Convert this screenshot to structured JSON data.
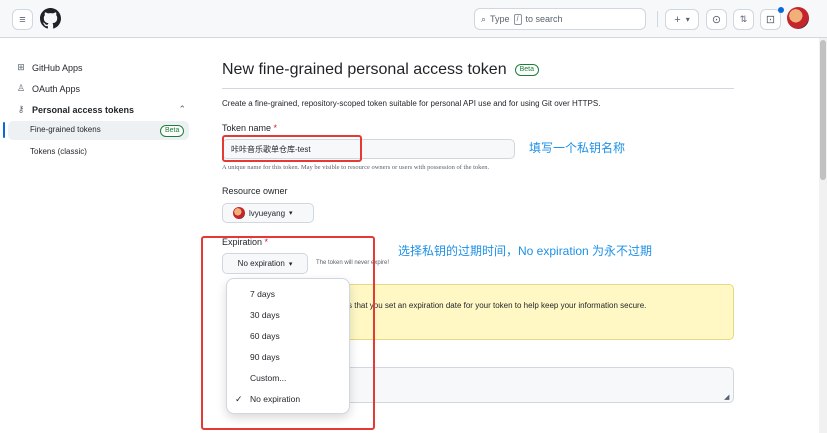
{
  "header": {
    "menu_icon": "hamburger-icon",
    "logo_icon": "github-logo-icon",
    "search_placeholder_pre": "Type",
    "search_key": "/",
    "search_placeholder_post": "to search",
    "plus_label": "+",
    "plus_caret": "▾",
    "issues_icon": "issue-circle-icon",
    "pr_icon": "pull-request-icon",
    "inbox_icon": "inbox-icon",
    "notification_color": "#0969da"
  },
  "sidebar": {
    "items": [
      {
        "icon": "apps-grid-icon",
        "glyph": "⊞",
        "label": "GitHub Apps"
      },
      {
        "icon": "person-icon",
        "glyph": "♙",
        "label": "OAuth Apps"
      },
      {
        "icon": "key-icon",
        "glyph": "⚷",
        "label": "Personal access tokens",
        "chevron": "⌃"
      }
    ],
    "sub_items": [
      {
        "label": "Fine-grained tokens",
        "badge": "Beta",
        "active": true
      },
      {
        "label": "Tokens (classic)"
      }
    ]
  },
  "main": {
    "title": "New fine-grained personal access token",
    "title_badge": "Beta",
    "description": "Create a fine-grained, repository-scoped token suitable for personal API use and for using Git over HTTPS.",
    "token_name_label": "Token name",
    "required_mark": "*",
    "token_name_value": "咔咔音乐歌单仓库-test",
    "token_name_hint": "A unique name for this token. May be visible to resource owners or users with possession of the token.",
    "resource_owner_label": "Resource owner",
    "resource_owner_value": "lvyueyang",
    "expiration_label": "Expiration",
    "expiration_value": "No expiration",
    "expiration_note": "The token will never expire!",
    "warning_text": "s that you set an expiration date for your token to help keep your information secure."
  },
  "dropdown": {
    "options": [
      "7 days",
      "30 days",
      "60 days",
      "90 days",
      "Custom...",
      "No expiration"
    ],
    "selected": "No expiration",
    "check_glyph": "✓"
  },
  "annotations": {
    "name_note": "填写一个私钥名称",
    "expiration_note": "选择私钥的过期时间，No expiration 为永不过期",
    "box_color": "#e53935",
    "text_color": "#1e90e6"
  },
  "colors": {
    "accent": "#0969da",
    "beta_green": "#1a7f37",
    "warning_bg": "#fff8c5"
  }
}
